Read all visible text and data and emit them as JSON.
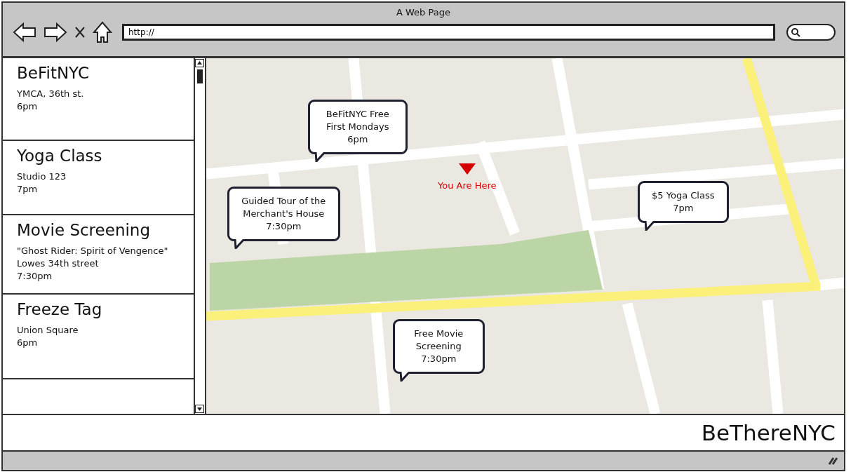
{
  "window": {
    "title": "A Web Page"
  },
  "toolbar": {
    "url": "http://"
  },
  "events": [
    {
      "title": "BeFitNYC",
      "details": [
        "YMCA, 36th st.",
        "6pm"
      ]
    },
    {
      "title": "Yoga Class",
      "details": [
        "Studio 123",
        "7pm"
      ]
    },
    {
      "title": "Movie Screening",
      "details": [
        "\"Ghost Rider: Spirit of Vengence\"",
        "Lowes 34th street",
        "7:30pm"
      ]
    },
    {
      "title": "Freeze Tag",
      "details": [
        "Union Square",
        "6pm"
      ]
    }
  ],
  "map": {
    "marker_label": "You Are Here",
    "callouts": [
      {
        "text": "BeFitNYC Free\nFirst Mondays\n6pm"
      },
      {
        "text": "Guided Tour of the\nMerchant's House\n7:30pm"
      },
      {
        "text": "$5 Yoga Class\n7pm"
      },
      {
        "text": "Free Movie\nScreening\n7:30pm"
      }
    ]
  },
  "footer": {
    "brand": "BeThereNYC"
  }
}
